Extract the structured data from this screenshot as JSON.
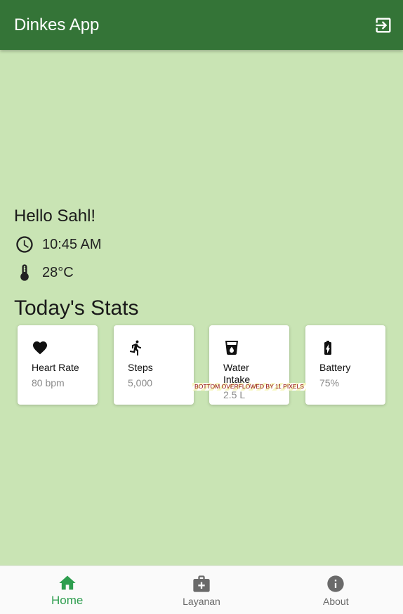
{
  "appbar": {
    "title": "Dinkes App",
    "logout_icon": "logout-icon"
  },
  "greeting": "Hello Sahl!",
  "time": {
    "icon": "clock-icon",
    "value": "10:45 AM"
  },
  "temperature": {
    "icon": "thermometer-icon",
    "value": "28°C"
  },
  "stats_title": "Today's Stats",
  "stats": [
    {
      "icon": "heart-icon",
      "label": "Heart Rate",
      "value": "80 bpm"
    },
    {
      "icon": "walk-icon",
      "label": "Steps",
      "value": "5,000"
    },
    {
      "icon": "water-icon",
      "label": "Water Intake",
      "value": "2.5 L"
    },
    {
      "icon": "battery-icon",
      "label": "Battery",
      "value": "75%"
    }
  ],
  "overflow_warning": "BOTTOM OVERFLOWED BY 11 PIXELS",
  "bottom_nav": [
    {
      "icon": "home-icon",
      "label": "Home",
      "active": true
    },
    {
      "icon": "medical-bag-icon",
      "label": "Layanan",
      "active": false
    },
    {
      "icon": "info-icon",
      "label": "About",
      "active": false
    }
  ],
  "colors": {
    "appbar": "#347437",
    "background": "#c9e4b4",
    "active_nav": "#2e9e4f"
  }
}
